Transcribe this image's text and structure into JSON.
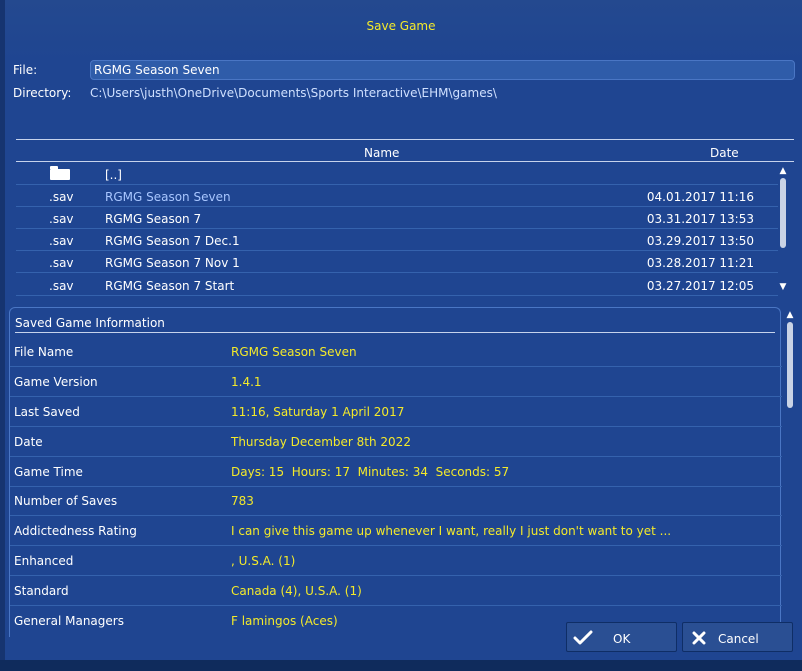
{
  "dialog": {
    "title": "Save Game"
  },
  "form": {
    "file_label": "File:",
    "file_value": "RGMG Season Seven",
    "directory_label": "Directory:",
    "directory_value": "C:\\Users\\justh\\OneDrive\\Documents\\Sports Interactive\\EHM\\games\\"
  },
  "file_list": {
    "col_name": "Name",
    "col_date": "Date",
    "parent_label": "[..]",
    "rows": [
      {
        "ext": ".sav",
        "name": "RGMG Season Seven",
        "date": "04.01.2017 11:16"
      },
      {
        "ext": ".sav",
        "name": "RGMG Season 7",
        "date": "03.31.2017 13:53"
      },
      {
        "ext": ".sav",
        "name": "RGMG Season 7 Dec.1",
        "date": "03.29.2017 13:50"
      },
      {
        "ext": ".sav",
        "name": "RGMG Season 7 Nov 1",
        "date": "03.28.2017 11:21"
      },
      {
        "ext": ".sav",
        "name": "RGMG Season 7 Start",
        "date": "03.27.2017 12:05"
      }
    ]
  },
  "info": {
    "title": "Saved Game Information",
    "rows": [
      {
        "key": "File Name",
        "value": "RGMG Season Seven"
      },
      {
        "key": "Game Version",
        "value": "1.4.1"
      },
      {
        "key": "Last Saved",
        "value": "11:16, Saturday 1 April 2017"
      },
      {
        "key": "Date",
        "value": "Thursday December 8th 2022"
      },
      {
        "key": "Game Time",
        "value": "Days: 15  Hours: 17  Minutes: 34  Seconds: 57"
      },
      {
        "key": "Number of Saves",
        "value": "783"
      },
      {
        "key": "Addictedness Rating",
        "value": "I can give this game up whenever I want, really I just don't want to yet ..."
      },
      {
        "key": "Enhanced",
        "value": ", U.S.A. (1)"
      },
      {
        "key": "Standard",
        "value": "Canada (4), U.S.A. (1)"
      },
      {
        "key": "General Managers",
        "value": "F lamingos (Aces)"
      }
    ]
  },
  "buttons": {
    "ok": "OK",
    "cancel": "Cancel"
  },
  "colors": {
    "background": "#1f4591",
    "accent_text": "#f4ea2a"
  },
  "icons": {
    "folder": "folder-icon",
    "ok": "checkmark-icon",
    "cancel": "close-icon"
  }
}
